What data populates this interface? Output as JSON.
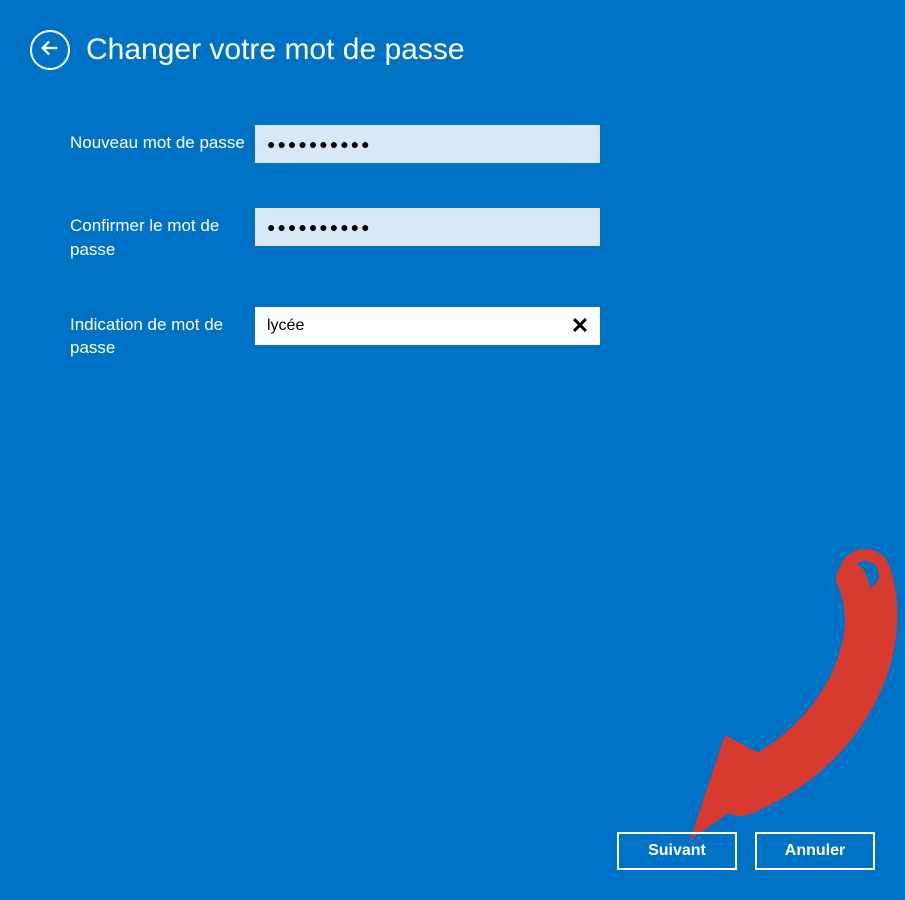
{
  "header": {
    "title": "Changer votre mot de passe"
  },
  "form": {
    "new_password": {
      "label": "Nouveau mot de passe",
      "value": "●●●●●●●●●●"
    },
    "confirm_password": {
      "label": "Confirmer le mot de passe",
      "value": "●●●●●●●●●●"
    },
    "hint": {
      "label": "Indication de mot de passe",
      "value": "lycée"
    }
  },
  "buttons": {
    "next": "Suivant",
    "cancel": "Annuler"
  },
  "colors": {
    "background": "#0072c6",
    "input_filled": "#d9e8f7",
    "annotation": "#d73a2f"
  }
}
